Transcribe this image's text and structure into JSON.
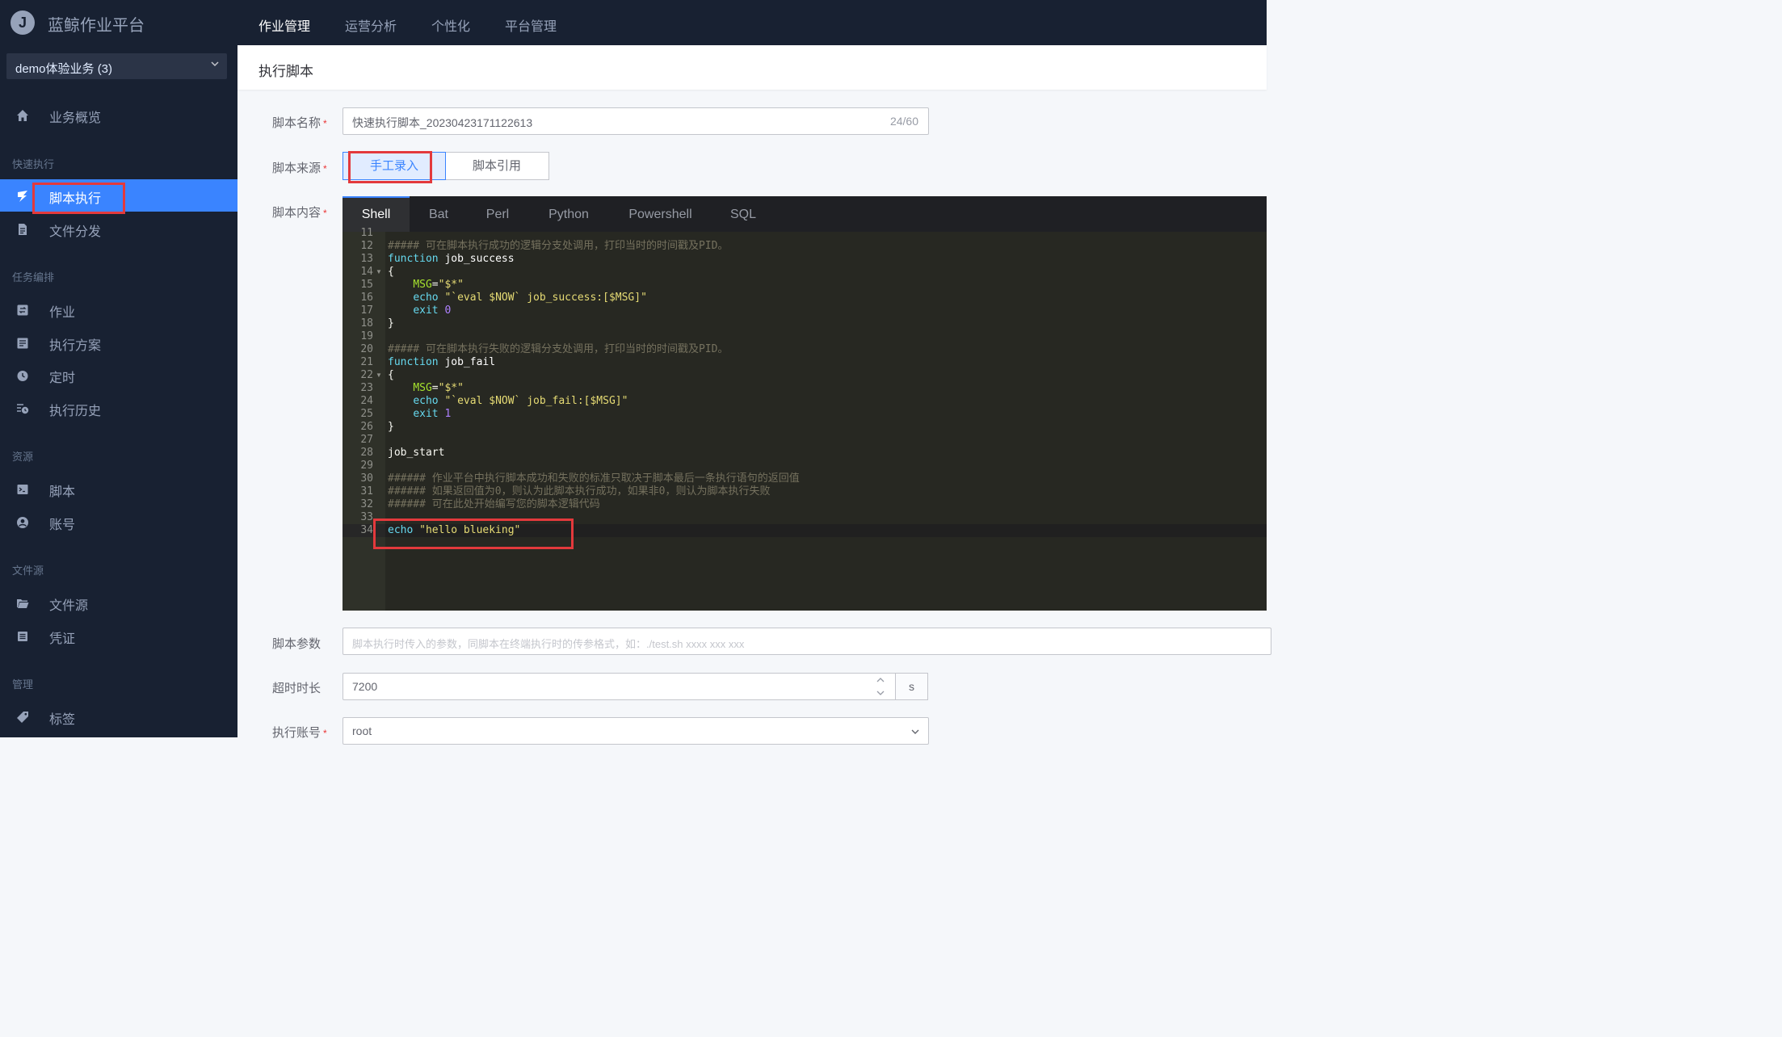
{
  "app": {
    "logo_letter": "J",
    "title": "蓝鲸作业平台"
  },
  "top_nav": [
    {
      "label": "作业管理",
      "active": true
    },
    {
      "label": "运营分析",
      "active": false
    },
    {
      "label": "个性化",
      "active": false
    },
    {
      "label": "平台管理",
      "active": false
    }
  ],
  "sidebar": {
    "business_select": "demo体验业务 (3)",
    "overview": "业务概览",
    "groups": {
      "quick": "快速执行",
      "task": "任务编排",
      "resource": "资源",
      "file_source": "文件源",
      "manage": "管理"
    },
    "items": {
      "script_exec": "脚本执行",
      "file_dist": "文件分发",
      "job": "作业",
      "plan": "执行方案",
      "cron": "定时",
      "history": "执行历史",
      "script": "脚本",
      "account": "账号",
      "file_source": "文件源",
      "ticket": "凭证",
      "tag": "标签"
    }
  },
  "page": {
    "title": "执行脚本"
  },
  "form": {
    "script_name": {
      "label": "脚本名称",
      "value": "快速执行脚本_20230423171122613",
      "counter": "24/60"
    },
    "script_source": {
      "label": "脚本来源",
      "options": [
        "手工录入",
        "脚本引用"
      ],
      "selected": "手工录入"
    },
    "script_content": {
      "label": "脚本内容"
    },
    "script_params": {
      "label": "脚本参数",
      "placeholder": "脚本执行时传入的参数，同脚本在终端执行时的传参格式，如：./test.sh xxxx xxx xxx"
    },
    "timeout": {
      "label": "超时时长",
      "value": "7200",
      "unit": "s"
    },
    "exec_account": {
      "label": "执行账号",
      "value": "root"
    }
  },
  "editor": {
    "tabs": [
      "Shell",
      "Bat",
      "Perl",
      "Python",
      "Powershell",
      "SQL"
    ],
    "active_tab": "Shell",
    "first_line_number": 11,
    "lines": [
      {
        "n": "11",
        "text": ""
      },
      {
        "n": "12",
        "text": "##### 可在脚本执行成功的逻辑分支处调用，打印当时的时间戳及PID。"
      },
      {
        "n": "13",
        "text": "function job_success"
      },
      {
        "n": "14",
        "text": "{",
        "fold": true
      },
      {
        "n": "15",
        "text": "    MSG=\"$*\""
      },
      {
        "n": "16",
        "text": "    echo \"`eval $NOW` job_success:[$MSG]\""
      },
      {
        "n": "17",
        "text": "    exit 0"
      },
      {
        "n": "18",
        "text": "}"
      },
      {
        "n": "19",
        "text": ""
      },
      {
        "n": "20",
        "text": "##### 可在脚本执行失败的逻辑分支处调用，打印当时的时间戳及PID。"
      },
      {
        "n": "21",
        "text": "function job_fail"
      },
      {
        "n": "22",
        "text": "{",
        "fold": true
      },
      {
        "n": "23",
        "text": "    MSG=\"$*\""
      },
      {
        "n": "24",
        "text": "    echo \"`eval $NOW` job_fail:[$MSG]\""
      },
      {
        "n": "25",
        "text": "    exit 1"
      },
      {
        "n": "26",
        "text": "}"
      },
      {
        "n": "27",
        "text": ""
      },
      {
        "n": "28",
        "text": "job_start"
      },
      {
        "n": "29",
        "text": ""
      },
      {
        "n": "30",
        "text": "###### 作业平台中执行脚本成功和失败的标准只取决于脚本最后一条执行语句的返回值"
      },
      {
        "n": "31",
        "text": "###### 如果返回值为0，则认为此脚本执行成功，如果非0，则认为脚本执行失败"
      },
      {
        "n": "32",
        "text": "###### 可在此处开始编写您的脚本逻辑代码"
      },
      {
        "n": "33",
        "text": ""
      },
      {
        "n": "34",
        "text": "echo \"hello blueking\""
      }
    ]
  },
  "colors": {
    "primary": "#3a84ff",
    "sidebar_bg": "#182132",
    "editor_bg": "#272822",
    "highlight_box": "#e3393c"
  }
}
